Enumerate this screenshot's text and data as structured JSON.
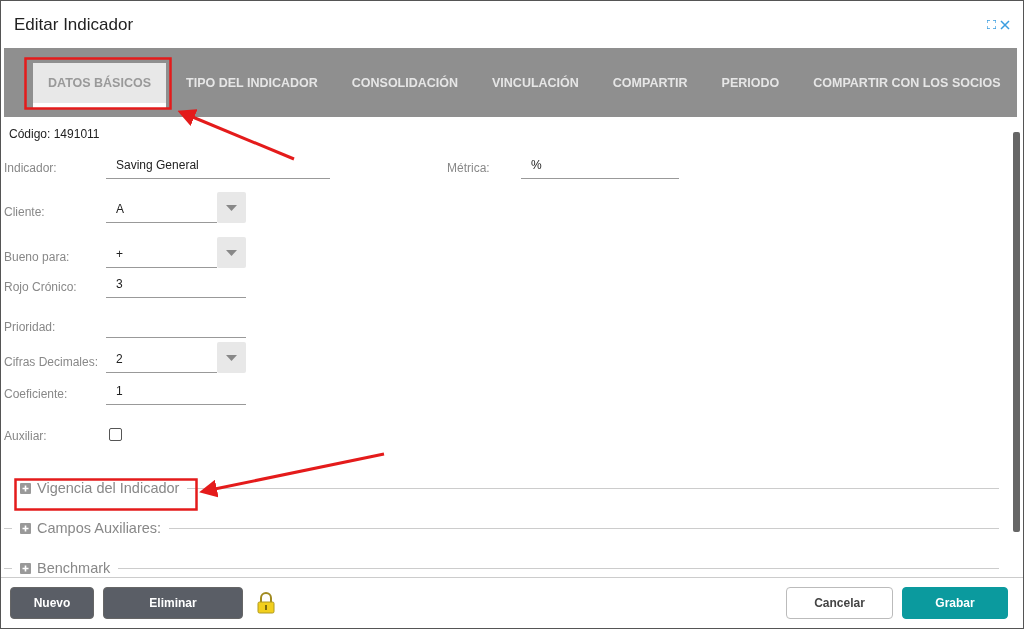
{
  "window": {
    "title": "Editar Indicador"
  },
  "tabs": [
    {
      "label": "DATOS BÁSICOS",
      "selected": true
    },
    {
      "label": "TIPO DEL INDICADOR",
      "selected": false
    },
    {
      "label": "CONSOLIDACIÓN",
      "selected": false
    },
    {
      "label": "VINCULACIÓN",
      "selected": false
    },
    {
      "label": "COMPARTIR",
      "selected": false
    },
    {
      "label": "PERIODO",
      "selected": false
    },
    {
      "label": "COMPARTIR CON LOS SOCIOS",
      "selected": false
    }
  ],
  "code": "Código: 1491011",
  "rows": [
    {
      "fields": [
        {
          "kind": "text",
          "label": "Indicador:",
          "value": "Saving General"
        },
        {
          "kind": "text",
          "label": "Métrica:",
          "value": "%"
        }
      ]
    },
    {
      "fields": [
        {
          "kind": "select",
          "label": "Cliente:",
          "value": "A"
        }
      ]
    },
    {
      "fields": [
        {
          "kind": "select",
          "label": "Bueno para:",
          "value": "+"
        }
      ]
    },
    {
      "fields": [
        {
          "kind": "text",
          "label": "Rojo Crónico:",
          "value": "3"
        }
      ]
    },
    {
      "fields": [
        {
          "kind": "text",
          "label": "Prioridad:"
        }
      ]
    },
    {
      "fields": [
        {
          "kind": "select",
          "label": "Cifras Decimales:",
          "value": "2"
        }
      ]
    },
    {
      "fields": [
        {
          "kind": "text",
          "label": "Coeficiente:",
          "value": "1"
        }
      ]
    },
    {
      "fields": [
        {
          "kind": "checkbox",
          "label": "Auxiliar:",
          "checked": false
        }
      ]
    }
  ],
  "sections": [
    {
      "title": "Vigencia del Indicador",
      "expanded": false
    },
    {
      "title": "Campos Auxiliares:",
      "expanded": false
    },
    {
      "title": "Benchmark",
      "expanded": false
    }
  ],
  "footer": {
    "left_buttons": [
      "Nuevo",
      "Eliminar"
    ],
    "right_buttons": [
      {
        "label": "Cancelar",
        "kind": "secondary"
      },
      {
        "label": "Grabar",
        "kind": "primary"
      }
    ]
  }
}
